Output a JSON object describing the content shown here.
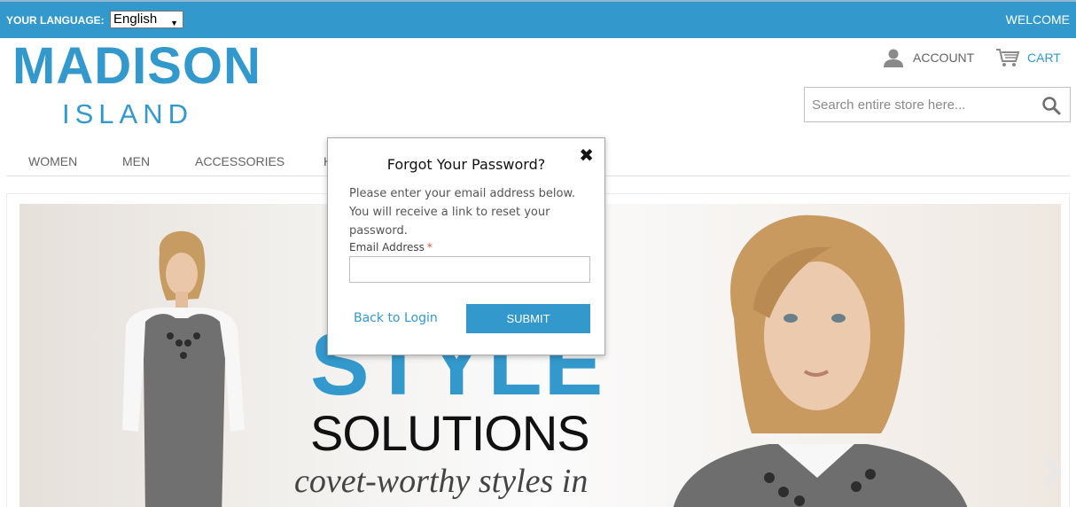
{
  "topbar": {
    "language_label": "YOUR LANGUAGE:",
    "language_value": "English",
    "welcome": "WELCOME"
  },
  "logo": {
    "main": "MADISON",
    "sub": "ISLAND"
  },
  "header": {
    "account_label": "ACCOUNT",
    "cart_label": "CART",
    "search_placeholder": "Search entire store here..."
  },
  "nav": {
    "items": [
      "WOMEN",
      "MEN",
      "ACCESSORIES",
      "H"
    ]
  },
  "hero": {
    "headline": "STYLE",
    "subhead": "SOLUTIONS",
    "tagline": "covet-worthy styles in"
  },
  "modal": {
    "title": "Forgot Your Password?",
    "description": "Please enter your email address below. You will receive a link to reset your password.",
    "email_label": "Email Address",
    "required_marker": "*",
    "email_value": "",
    "back_link": "Back to Login",
    "submit_label": "SUBMIT",
    "close_icon": "close-icon"
  },
  "colors": {
    "brand": "#3399cc",
    "text": "#636363"
  }
}
